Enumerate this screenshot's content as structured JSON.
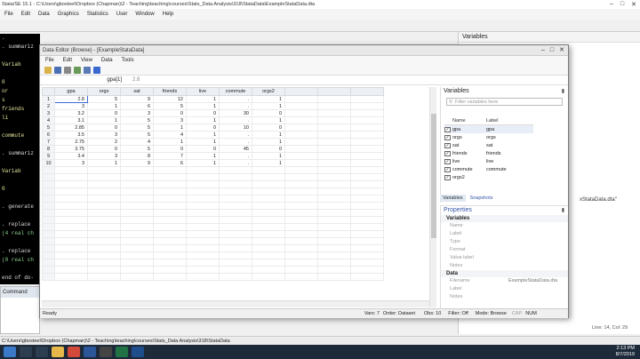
{
  "stata": {
    "title": "Stata/SE 15.1 - C:\\Users\\gbosteel\\Dropbox (Chapman)\\2 - Teaching\\teaching\\courses\\Stats_Data Analysis\\318\\StataData\\ExampleStataData.dta",
    "menu": [
      "File",
      "Edit",
      "Data",
      "Graphics",
      "Statistics",
      "User",
      "Window",
      "Help"
    ],
    "results_lines": [
      {
        "t": ".",
        "c": "w"
      },
      {
        "t": ". summariz",
        "c": "w"
      },
      {
        "t": "",
        "c": "w"
      },
      {
        "t": "  Variab",
        "c": "y"
      },
      {
        "t": "",
        "c": "w"
      },
      {
        "t": "       0",
        "c": "y"
      },
      {
        "t": "      or",
        "c": "y"
      },
      {
        "t": "       s",
        "c": "y"
      },
      {
        "t": "  friends",
        "c": "y"
      },
      {
        "t": "      li",
        "c": "y"
      },
      {
        "t": "",
        "c": "w"
      },
      {
        "t": "   commute",
        "c": "y"
      },
      {
        "t": "",
        "c": "w"
      },
      {
        "t": ". summariz",
        "c": "w"
      },
      {
        "t": "",
        "c": "w"
      },
      {
        "t": "  Variab",
        "c": "y"
      },
      {
        "t": "",
        "c": "w"
      },
      {
        "t": "       0",
        "c": "y"
      },
      {
        "t": "",
        "c": "w"
      },
      {
        "t": ". generate",
        "c": "w"
      },
      {
        "t": "",
        "c": "w"
      },
      {
        "t": ". replace",
        "c": "w"
      },
      {
        "t": "(4 real ch",
        "c": "c"
      },
      {
        "t": "",
        "c": "w"
      },
      {
        "t": ". replace",
        "c": "w"
      },
      {
        "t": "(0 real ch",
        "c": "c"
      },
      {
        "t": "",
        "c": "w"
      },
      {
        "t": "end of do-",
        "c": "w"
      }
    ],
    "command_title": "Command",
    "status_path": "C:\\Users\\gbosteel\\Dropbox (Chapman)\\2 - Teaching\\teaching\\courses\\Stats_Data Analysis\\318\\StataData",
    "right_vars_title": "Variables",
    "right_vars_snippet": "xStataData.dta\"",
    "right_vars_info": "Line: 14, Col: 29"
  },
  "editor": {
    "title": "Data Editor (Browse) - [ExampleStataData]",
    "menu": [
      "File",
      "Edit",
      "View",
      "Data",
      "Tools"
    ],
    "cell_ref": "gpa[1]",
    "cell_value": "2.8",
    "columns": [
      "gpa",
      "orgs",
      "sat",
      "friends",
      "live",
      "commute",
      "orgs2"
    ],
    "rows": [
      [
        "2.8",
        "5",
        "9",
        "12",
        "1",
        ".",
        "1"
      ],
      [
        "3",
        "1",
        "6",
        "5",
        "1",
        ".",
        "1"
      ],
      [
        "3.2",
        "0",
        "3",
        "0",
        "0",
        "30",
        "0"
      ],
      [
        "3.1",
        "1",
        "5",
        "3",
        "1",
        ".",
        "1"
      ],
      [
        "2.85",
        "0",
        "5",
        "1",
        "0",
        "10",
        "0"
      ],
      [
        "3.5",
        "3",
        "5",
        "4",
        "1",
        ".",
        "1"
      ],
      [
        "2.75",
        "2",
        "4",
        "1",
        "1",
        ".",
        "1"
      ],
      [
        "3.75",
        "0",
        "5",
        "0",
        "0",
        "45",
        "0"
      ],
      [
        "3.4",
        "3",
        "8",
        "7",
        "1",
        ".",
        "1"
      ],
      [
        "3",
        "1",
        "9",
        "6",
        "1",
        ".",
        "1"
      ]
    ],
    "vars_title": "Variables",
    "filter_placeholder": "Filter variables here",
    "vars_header": {
      "name": "Name",
      "label": "Label"
    },
    "variables": [
      {
        "name": "gpa",
        "label": "gpa"
      },
      {
        "name": "orgs",
        "label": "orgs"
      },
      {
        "name": "sat",
        "label": "sat"
      },
      {
        "name": "friends",
        "label": "friends"
      },
      {
        "name": "live",
        "label": "live"
      },
      {
        "name": "commute",
        "label": "commute"
      },
      {
        "name": "orgs2",
        "label": ""
      }
    ],
    "tabs": [
      "Variables",
      "Snapshots"
    ],
    "props_title": "Properties",
    "props_var_section": "Variables",
    "props_var_rows": [
      "Name",
      "Label",
      "Type",
      "Format",
      "Value label",
      "Notes"
    ],
    "props_data_section": "Data",
    "props_data_rows": [
      {
        "k": "Filename",
        "v": "ExampleStataData.dta"
      },
      {
        "k": "Label",
        "v": ""
      },
      {
        "k": "Notes",
        "v": ""
      }
    ],
    "status": {
      "ready": "Ready",
      "vars": "Vars: 7",
      "order": "Order: Dataset",
      "obs": "Obs: 10",
      "filter": "Filter: Off",
      "mode": "Mode: Browse",
      "cap": "CAP",
      "num": "NUM"
    }
  },
  "taskbar": {
    "time": "2:13 PM",
    "date": "8/7/2019"
  }
}
